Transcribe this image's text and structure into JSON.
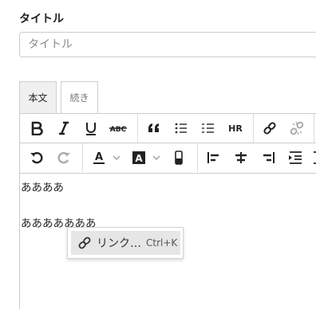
{
  "title_field": {
    "label": "タイトル",
    "placeholder": "タイトル",
    "value": ""
  },
  "tabs": [
    {
      "label": "本文",
      "active": true
    },
    {
      "label": "続き",
      "active": false
    }
  ],
  "toolbar": {
    "row1": [
      "bold-icon",
      "italic-icon",
      "underline-icon",
      "strikethrough-icon",
      "blockquote-icon",
      "bulleted-list-icon",
      "numbered-list-icon",
      "horizontal-rule-icon",
      "link-icon",
      "unlink-icon"
    ],
    "hr_label": "HR",
    "row2": [
      "undo-icon",
      "redo-icon",
      "font-color-icon",
      "chevron-down-icon",
      "background-color-icon",
      "chevron-down-icon",
      "font-size-icon",
      "align-left-icon",
      "align-center-icon",
      "align-right-icon",
      "indent-icon"
    ]
  },
  "editor": {
    "lines": [
      "ああああ",
      "あああああああ"
    ]
  },
  "context_menu": {
    "items": [
      {
        "icon": "link-icon",
        "label": "リンク…",
        "shortcut": "Ctrl+K"
      }
    ]
  },
  "colors": {
    "border": "#cccccc",
    "tab_active_bg": "#f0f0f0",
    "menu_hover_bg": "#e6e6e6",
    "text": "#222222"
  }
}
